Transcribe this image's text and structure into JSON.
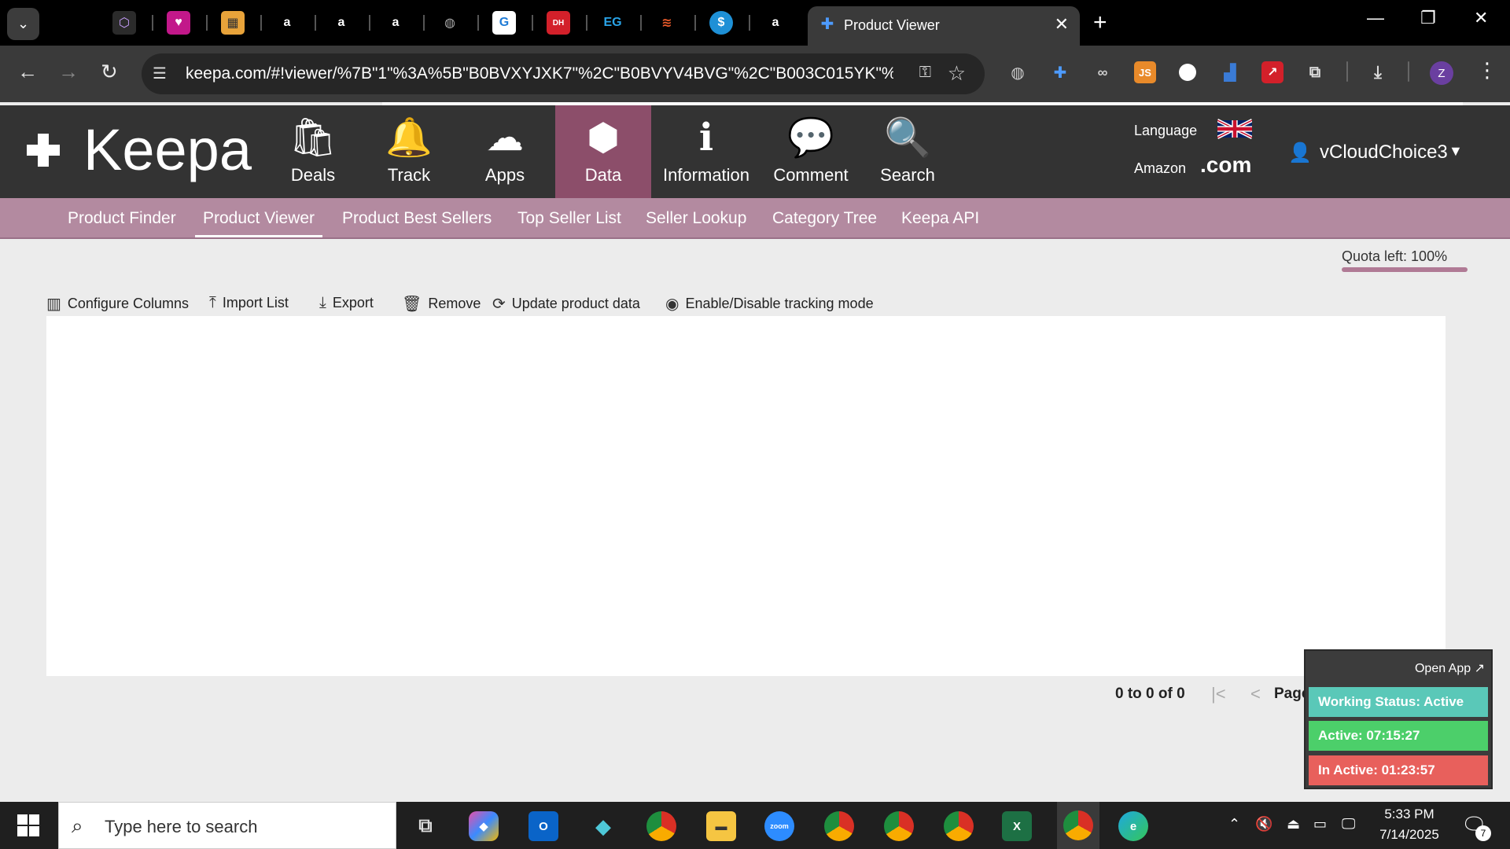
{
  "browser": {
    "active_tab_title": "Product Viewer",
    "new_tab_symbol": "+",
    "close_symbol": "✕",
    "url": "keepa.com/#!viewer/%7B\"1\"%3A%5B\"B0BVXYJXK7\"%2C\"B0BVYV4BVG\"%2C\"B003C015YK\"%2C\"...",
    "profile_initial": "Z"
  },
  "keepa": {
    "logo_text": "Keepa",
    "nav": [
      {
        "label": "Deals",
        "icon": "shopping-bag-icon"
      },
      {
        "label": "Track",
        "icon": "bell-icon"
      },
      {
        "label": "Apps",
        "icon": "cloud-download-icon"
      },
      {
        "label": "Data",
        "icon": "cube-icon"
      },
      {
        "label": "Information",
        "icon": "info-icon"
      },
      {
        "label": "Comment",
        "icon": "comments-icon"
      },
      {
        "label": "Search",
        "icon": "search-icon"
      }
    ],
    "active_nav": "Data",
    "language_label": "Language",
    "amazon_label": "Amazon",
    "amazon_domain": ".com",
    "username": "vCloudChoice3"
  },
  "subnav": {
    "items": [
      "Product Finder",
      "Product Viewer",
      "Product Best Sellers",
      "Top Seller List",
      "Seller Lookup",
      "Category Tree",
      "Keepa API"
    ],
    "active": "Product Viewer"
  },
  "content": {
    "quota": "Quota left: 100%",
    "toolbar": [
      "Configure Columns",
      "Import List",
      "Export",
      "Remove",
      "Update product data",
      "Enable/Disable tracking mode"
    ],
    "pager_count": "0 to 0 of 0",
    "pager_page": "Page 0 of 0"
  },
  "widget": {
    "open_app": "Open App ↗",
    "status": "Working Status: Active",
    "active": "Active: 07:15:27",
    "inactive": "In Active: 01:23:57"
  },
  "taskbar": {
    "search_placeholder": "Type here to search",
    "time": "5:33 PM",
    "date": "7/14/2025",
    "notification_count": "7"
  },
  "colors": {
    "keepa_header": "#333333",
    "keepa_active": "#8c4e6a",
    "subnav": "#b38aa0",
    "widget_status": "#5ac8b8",
    "widget_active": "#4ccf6a",
    "widget_inactive": "#e8605c"
  }
}
